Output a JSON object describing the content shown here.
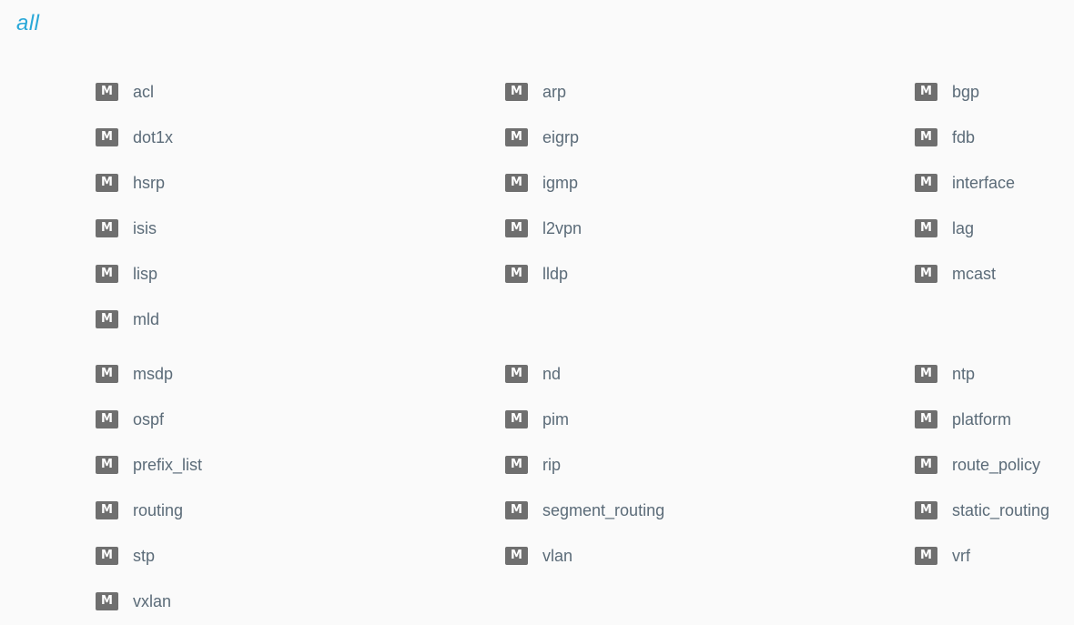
{
  "title": "all",
  "badge_letter": "M",
  "accent_color": "#29a8d8",
  "badge_color": "#6f6f6f",
  "rows": [
    [
      "acl",
      "arp",
      "bgp"
    ],
    [
      "dot1x",
      "eigrp",
      "fdb"
    ],
    [
      "hsrp",
      "igmp",
      "interface"
    ],
    [
      "isis",
      "l2vpn",
      "lag"
    ],
    [
      "lisp",
      "lldp",
      "mcast"
    ],
    [
      "mld"
    ],
    [
      "msdp",
      "nd",
      "ntp"
    ],
    [
      "ospf",
      "pim",
      "platform"
    ],
    [
      "prefix_list",
      "rip",
      "route_policy"
    ],
    [
      "routing",
      "segment_routing",
      "static_routing"
    ],
    [
      "stp",
      "vlan",
      "vrf"
    ],
    [
      "vxlan"
    ]
  ]
}
